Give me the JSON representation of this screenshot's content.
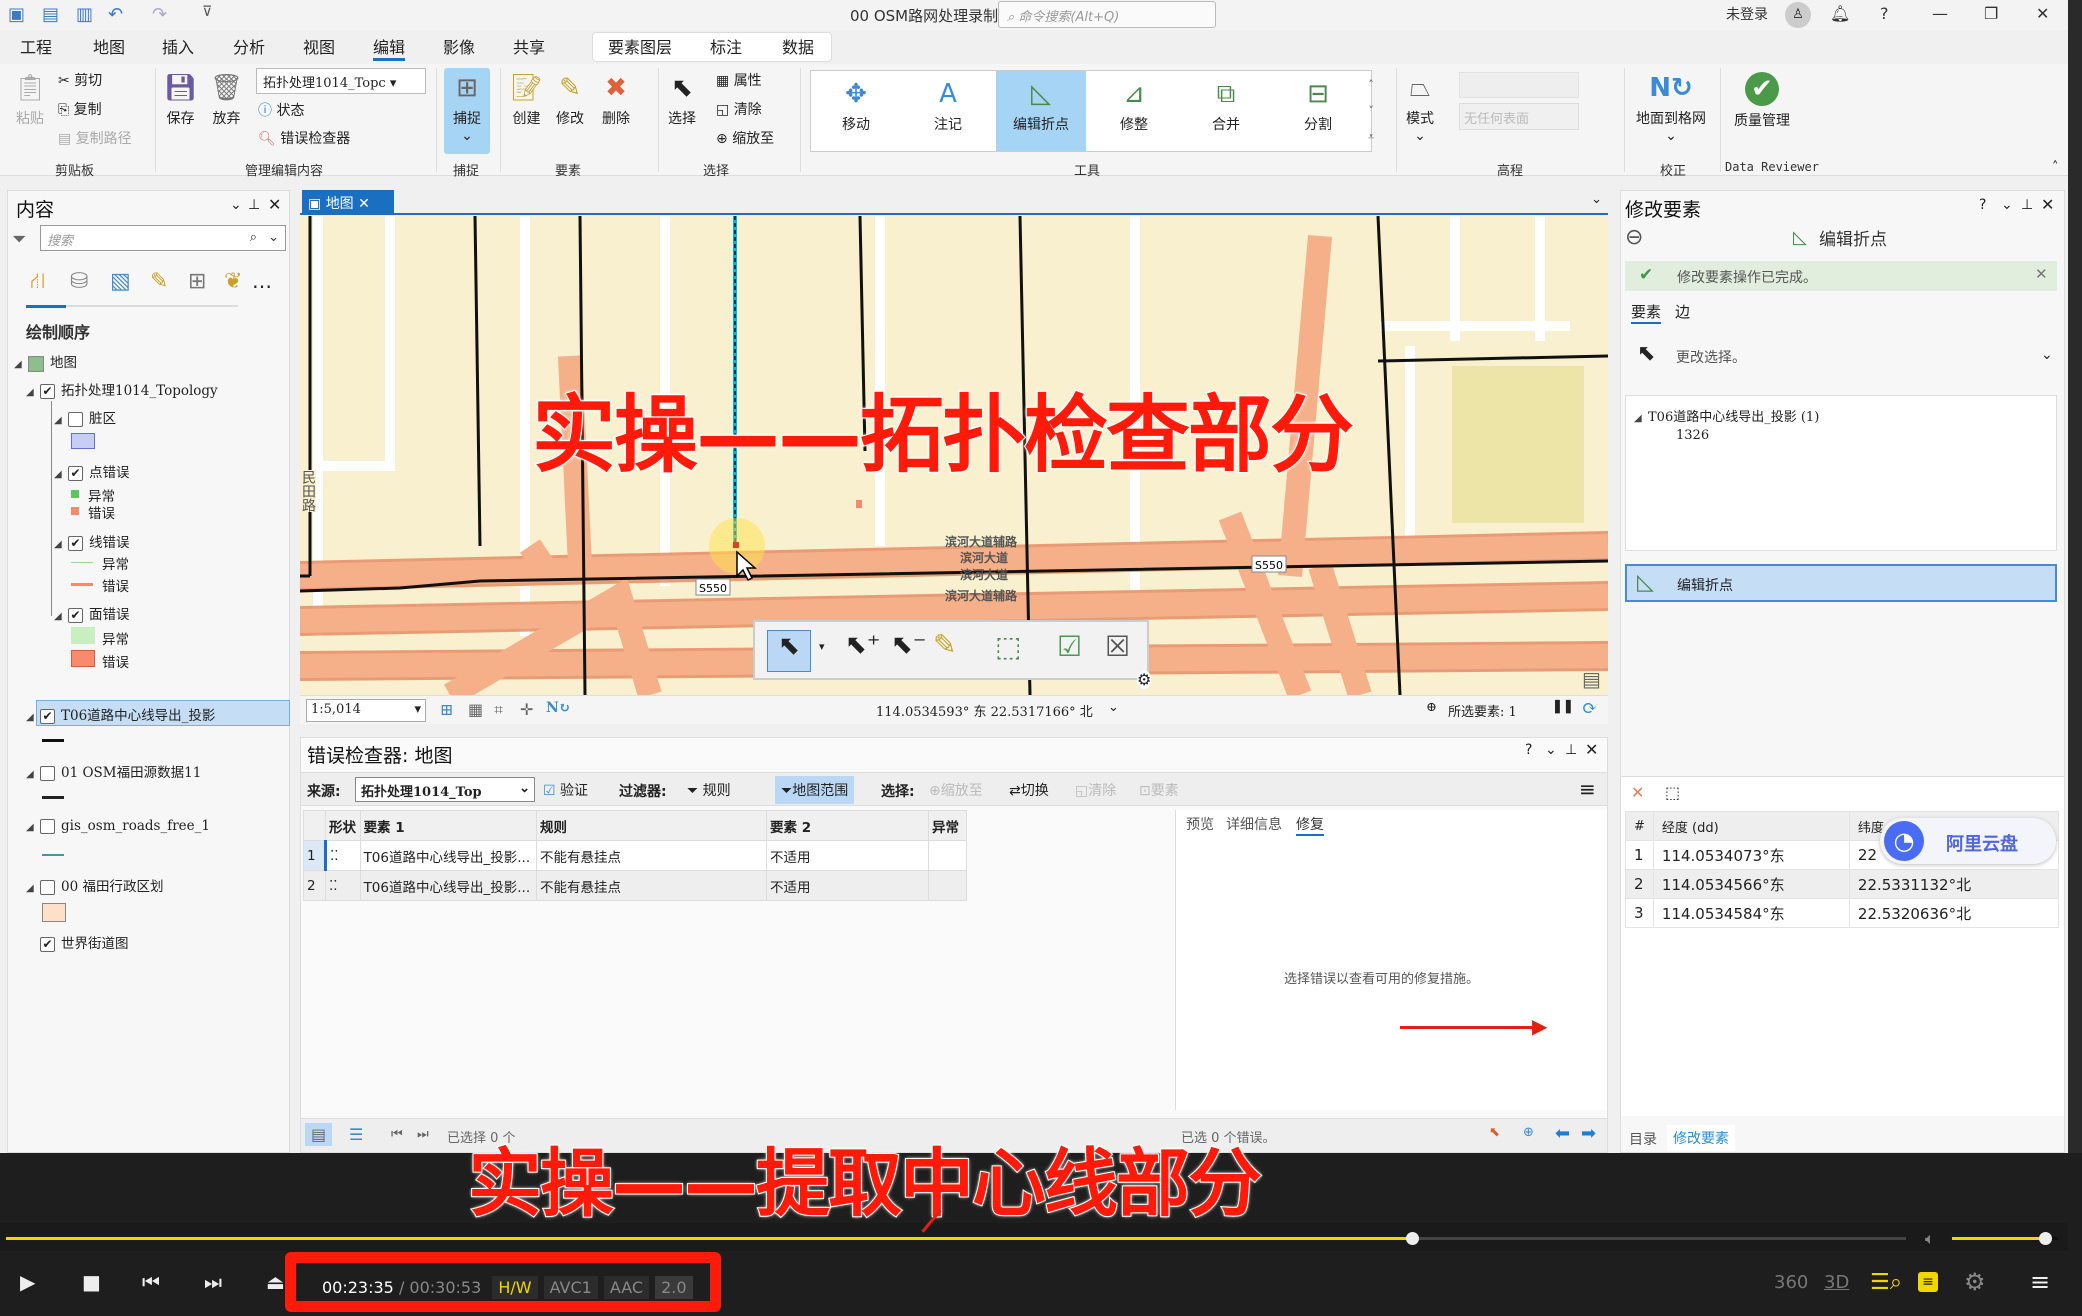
{
  "window": {
    "title": "00 OSM路网处理录制",
    "command_search_placeholder": "命令搜索(Alt+Q)",
    "user": "未登录"
  },
  "menu_tabs": [
    "工程",
    "地图",
    "插入",
    "分析",
    "视图",
    "编辑",
    "影像",
    "共享"
  ],
  "context_tabs": [
    "要素图层",
    "标注",
    "数据"
  ],
  "active_tab": "编辑",
  "ribbon": {
    "clipboard": {
      "paste": "粘贴",
      "cut": "剪切",
      "copy": "复制",
      "copy_path": "复制路径",
      "group": "剪贴板"
    },
    "manage": {
      "save": "保存",
      "discard": "放弃",
      "workspace": "拓扑处理1014_Topc",
      "status": "状态",
      "error_inspector": "错误检查器",
      "group": "管理编辑内容"
    },
    "snapping": {
      "snap": "捕捉",
      "group": "捕捉"
    },
    "features": {
      "create": "创建",
      "modify": "修改",
      "delete": "删除",
      "group": "要素"
    },
    "selection": {
      "select": "选择",
      "attributes": "属性",
      "clear": "清除",
      "zoom_to": "缩放至",
      "group": "选择"
    },
    "tools": {
      "items": [
        "移动",
        "注记",
        "编辑折点",
        "修整",
        "合并",
        "分割"
      ],
      "active": "编辑折点",
      "group": "工具"
    },
    "elevation": {
      "mode": "模式",
      "surface_placeholder": "无任何表面",
      "group": "高程"
    },
    "correction": {
      "ground_to_grid": "地面到格网",
      "group": "校正"
    },
    "reviewer": {
      "quality": "质量管理",
      "group": "Data Reviewer"
    }
  },
  "contents": {
    "title": "内容",
    "search_placeholder": "搜索",
    "section": "绘制顺序",
    "map": "地图",
    "topology": "拓扑处理1014_Topology",
    "dirty": "脏区",
    "point_errors": "点错误",
    "line_errors": "线错误",
    "poly_errors": "面错误",
    "exception": "异常",
    "error": "错误",
    "layers": [
      "T06道路中心线导出_投影",
      "01 OSM福田源数据11",
      "gis_osm_roads_free_1",
      "00 福田行政区划",
      "世界街道图"
    ],
    "colors": {
      "dirty": "#c8cdf5",
      "pt_exception": "#5ac85a",
      "pt_error": "#f58a70",
      "ln_exception": "#9bd69b",
      "ln_error": "#f58a70",
      "pg_exception": "#c8efc0",
      "pg_error": "#fa8a6e",
      "admin": "#fde0c8"
    }
  },
  "map": {
    "tab": "地图",
    "labels": [
      "滨河大道辅路",
      "滨河大道",
      "滨河大道",
      "滨河大道辅路",
      "S550",
      "S550",
      "民田路"
    ],
    "scale": "1:5,014",
    "coords": "114.0534593° 东  22.5317166° 北",
    "selected": "所选要素: 1",
    "colors": {
      "land": "#f8f0cf",
      "road": "#f5b08a",
      "road_edge": "#e8946a",
      "line": "#111111"
    }
  },
  "overlays": {
    "top": "实操——拓扑检查部分",
    "bottom": "实操——提取中心线部分"
  },
  "error_inspector": {
    "title": "错误检查器: 地图",
    "source_label": "来源:",
    "source": "拓扑处理1014_Top",
    "validate": "验证",
    "filter_label": "过滤器:",
    "rules": "规则",
    "extent": "地图范围",
    "select_label": "选择:",
    "zoom": "缩放至",
    "switch": "切换",
    "clear": "清除",
    "features": "要素",
    "columns": [
      "形状",
      "要素 1",
      "规则",
      "要素 2",
      "异常"
    ],
    "rows": [
      {
        "n": "1",
        "f1": "T06道路中心线导出_投影...",
        "rule": "不能有悬挂点",
        "f2": "不适用",
        "ex": ""
      },
      {
        "n": "2",
        "f1": "T06道路中心线导出_投影...",
        "rule": "不能有悬挂点",
        "f2": "不适用",
        "ex": ""
      }
    ],
    "detail_tabs": [
      "预览",
      "详细信息",
      "修复"
    ],
    "detail_active": "修复",
    "detail_message": "选择错误以查看可用的修复措施。",
    "footer_left": "已选择 0 个",
    "footer_right": "已选 0 个错误。"
  },
  "modify": {
    "title": "修改要素",
    "tool": "编辑折点",
    "message": "修改要素操作已完成。",
    "tabs": [
      "要素",
      "边"
    ],
    "tab_active": "要素",
    "change_selection": "更改选择。",
    "tree_layer": "T06道路中心线导出_投影 (1)",
    "tree_id": "1326",
    "tool_button": "编辑折点",
    "vertex_columns": [
      "#",
      "经度 (dd)",
      "纬度"
    ],
    "vertices": [
      {
        "n": "1",
        "lon": "114.0534073°东",
        "lat": "22"
      },
      {
        "n": "2",
        "lon": "114.0534566°东",
        "lat": "22.5331132°北"
      },
      {
        "n": "3",
        "lon": "114.0534584°东",
        "lat": "22.5320636°北"
      }
    ],
    "bottom_tabs": [
      "目录",
      "修改要素"
    ],
    "bottom_active": "修改要素"
  },
  "watermark": "阿里云盘",
  "player": {
    "current": "00:23:35",
    "total": "00:30:53",
    "hw": "H/W",
    "video": "AVC1",
    "audio": "AAC",
    "channels": "2.0",
    "progress_pct": 74,
    "volume_pct": 88,
    "accent": "#f2d600",
    "icons": [
      "360",
      "3D"
    ]
  }
}
